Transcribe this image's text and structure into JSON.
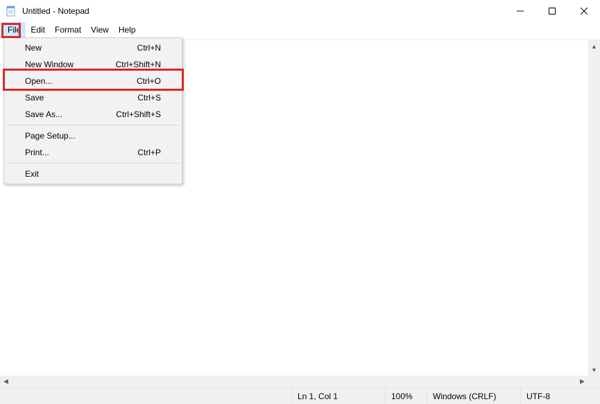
{
  "window": {
    "title": "Untitled - Notepad"
  },
  "menubar": {
    "items": [
      "File",
      "Edit",
      "Format",
      "View",
      "Help"
    ],
    "active": "File"
  },
  "file_menu": {
    "items": [
      {
        "label": "New",
        "shortcut": "Ctrl+N"
      },
      {
        "label": "New Window",
        "shortcut": "Ctrl+Shift+N"
      },
      {
        "label": "Open...",
        "shortcut": "Ctrl+O",
        "highlighted": true
      },
      {
        "label": "Save",
        "shortcut": "Ctrl+S"
      },
      {
        "label": "Save As...",
        "shortcut": "Ctrl+Shift+S"
      },
      {
        "sep": true
      },
      {
        "label": "Page Setup...",
        "shortcut": ""
      },
      {
        "label": "Print...",
        "shortcut": "Ctrl+P"
      },
      {
        "sep": true
      },
      {
        "label": "Exit",
        "shortcut": ""
      }
    ]
  },
  "statusbar": {
    "position": "Ln 1, Col 1",
    "zoom": "100%",
    "eol": "Windows (CRLF)",
    "encoding": "UTF-8"
  }
}
